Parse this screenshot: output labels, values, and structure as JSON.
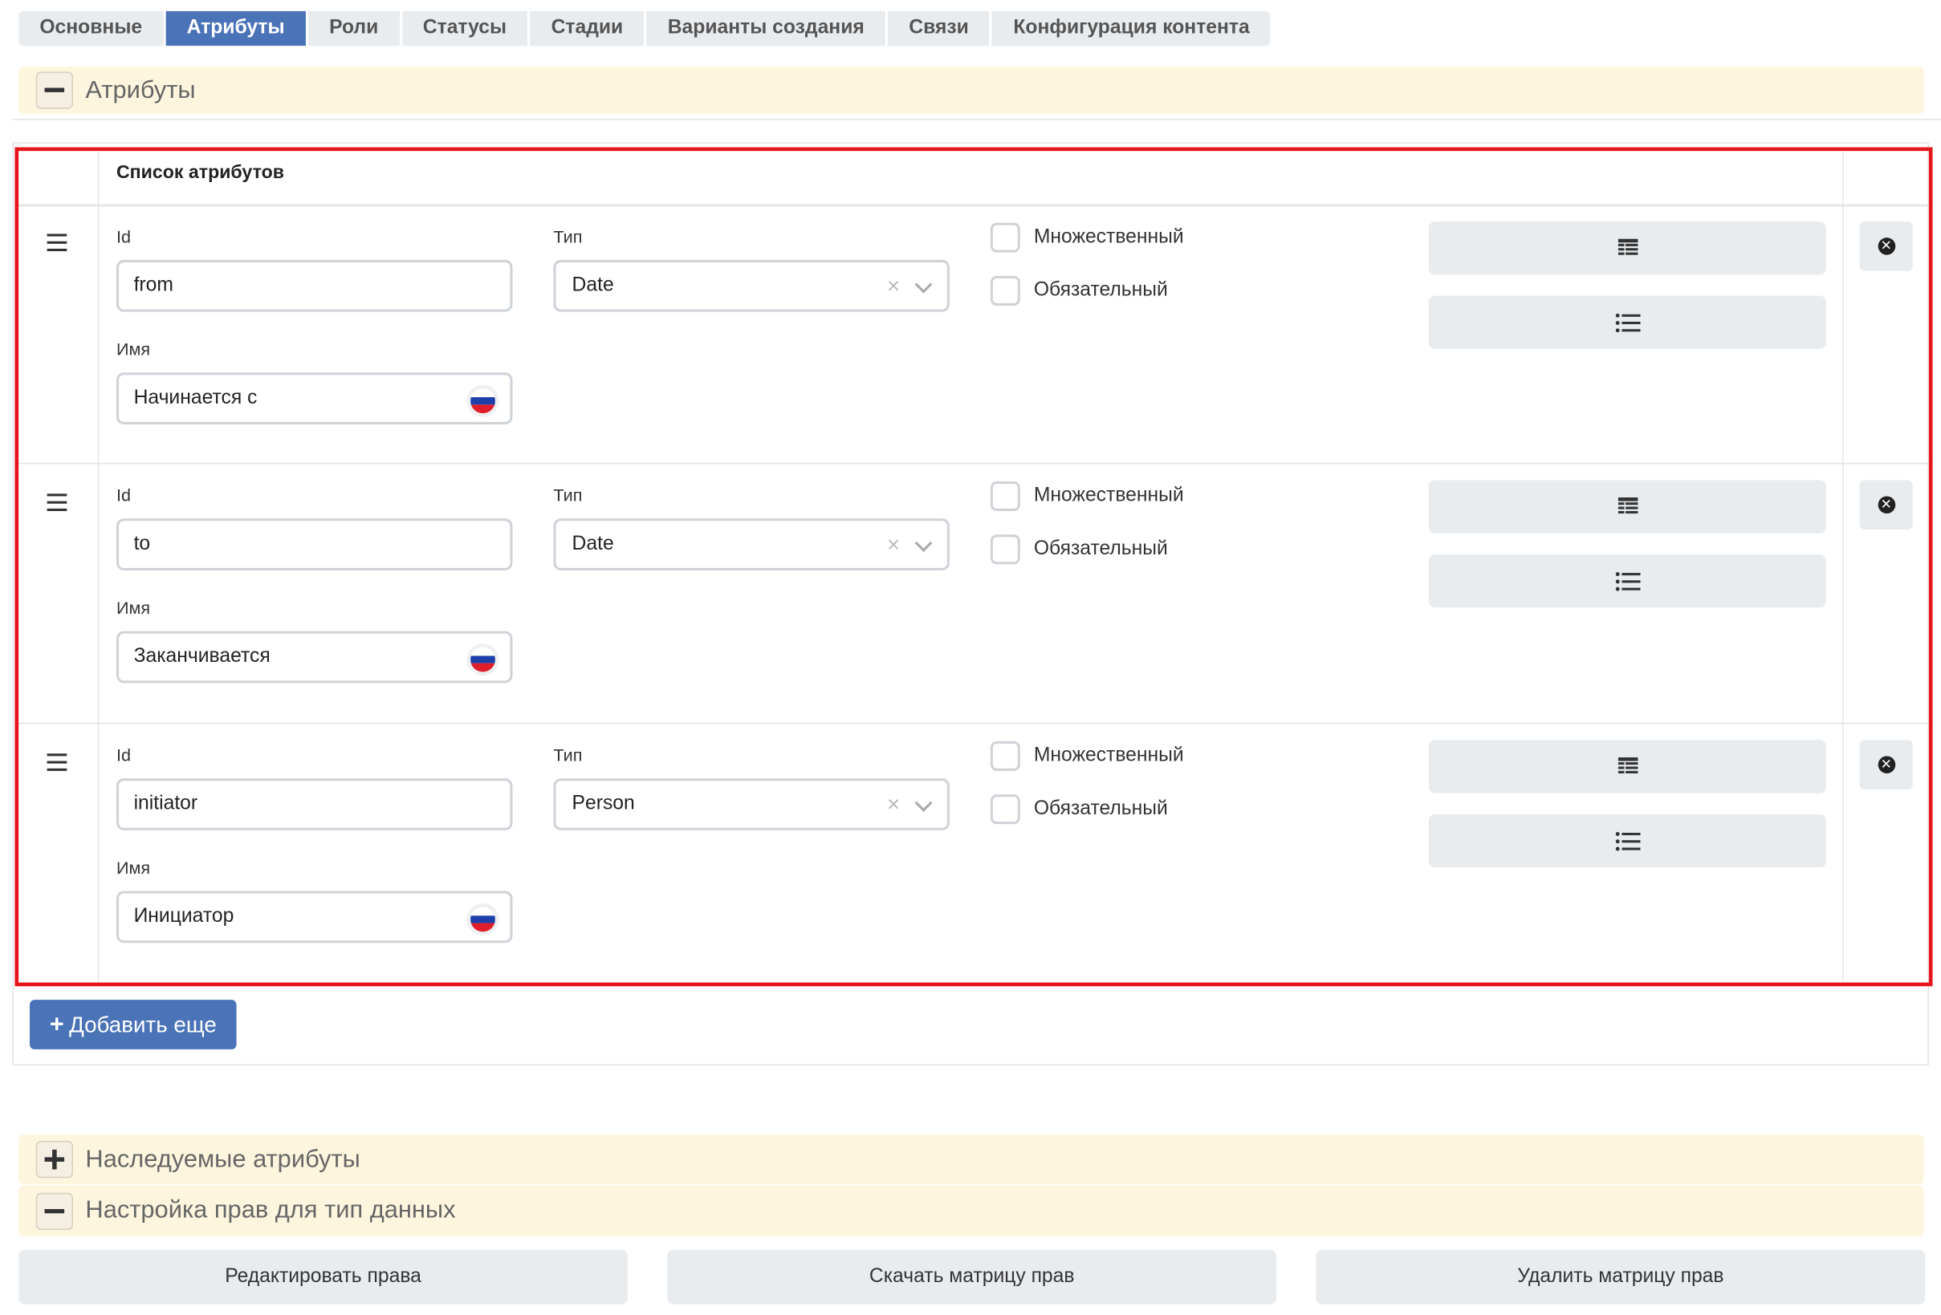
{
  "tabs": [
    {
      "label": "Основные",
      "active": false
    },
    {
      "label": "Атрибуты",
      "active": true
    },
    {
      "label": "Роли",
      "active": false
    },
    {
      "label": "Статусы",
      "active": false
    },
    {
      "label": "Стадии",
      "active": false
    },
    {
      "label": "Варианты создания",
      "active": false
    },
    {
      "label": "Связи",
      "active": false
    },
    {
      "label": "Конфигурация контента",
      "active": false
    }
  ],
  "attributes_section": {
    "title": "Атрибуты",
    "toggle": "collapse"
  },
  "list": {
    "title": "Список атрибутов",
    "id_label": "Id",
    "type_label": "Тип",
    "name_label": "Имя",
    "multiple_label": "Множественный",
    "required_label": "Обязательный",
    "rows": [
      {
        "id": "from",
        "type": "Date",
        "name": "Начинается с",
        "multiple": false,
        "required": false
      },
      {
        "id": "to",
        "type": "Date",
        "name": "Заканчивается",
        "multiple": false,
        "required": false
      },
      {
        "id": "initiator",
        "type": "Person",
        "name": "Инициатор",
        "multiple": false,
        "required": false
      }
    ]
  },
  "add_button": {
    "label": "Добавить еще",
    "icon": "plus-icon"
  },
  "inherited_section": {
    "title": "Наследуемые атрибуты",
    "toggle": "expand"
  },
  "permissions_section": {
    "title": "Настройка прав для тип данных",
    "toggle": "collapse"
  },
  "bottom_buttons": {
    "edit": "Редактировать права",
    "download": "Скачать матрицу прав",
    "delete": "Удалить матрицу прав"
  },
  "colors": {
    "accent": "#4a73b8",
    "highlight": "#e8141b",
    "section_bg": "#fdf5de"
  }
}
